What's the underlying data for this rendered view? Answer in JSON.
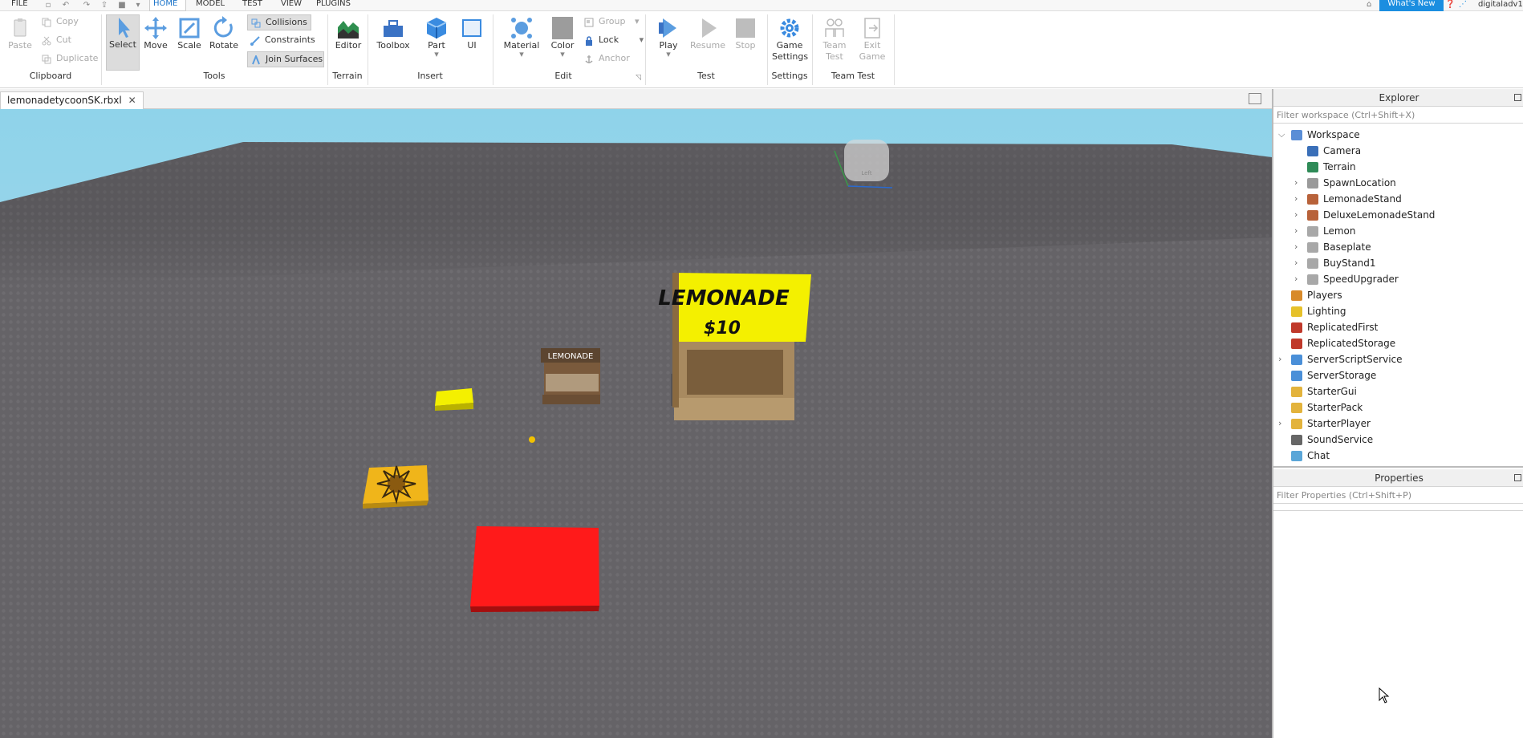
{
  "menubar": {
    "file": "FILE",
    "tabs": [
      "HOME",
      "MODEL",
      "TEST",
      "VIEW",
      "PLUGINS"
    ],
    "whats_new": "What's New",
    "username": "digitaladv1"
  },
  "ribbon": {
    "clipboard": {
      "paste": "Paste",
      "copy": "Copy",
      "cut": "Cut",
      "duplicate": "Duplicate",
      "group_label": "Clipboard"
    },
    "tools": {
      "select": "Select",
      "move": "Move",
      "scale": "Scale",
      "rotate": "Rotate",
      "collisions": "Collisions",
      "constraints": "Constraints",
      "join_surfaces": "Join Surfaces",
      "group_label": "Tools"
    },
    "terrain": {
      "editor": "Editor",
      "group_label": "Terrain"
    },
    "insert": {
      "toolbox": "Toolbox",
      "part": "Part",
      "ui": "UI",
      "group_label": "Insert"
    },
    "edit": {
      "material": "Material",
      "color": "Color",
      "group": "Group",
      "lock": "Lock",
      "anchor": "Anchor",
      "group_label": "Edit"
    },
    "test": {
      "play": "Play",
      "resume": "Resume",
      "stop": "Stop",
      "group_label": "Test"
    },
    "settings": {
      "game_settings_1": "Game",
      "game_settings_2": "Settings",
      "group_label": "Settings"
    },
    "team_test": {
      "team_test_1": "Team",
      "team_test_2": "Test",
      "exit_game_1": "Exit",
      "exit_game_2": "Game",
      "group_label": "Team Test"
    }
  },
  "document_tab": {
    "name": "lemonadetycoonSK.rbxl",
    "close": "✕"
  },
  "viewport": {
    "stand_big_sign_line1": "LEMONADE",
    "stand_big_sign_line2": "$10",
    "stand_small_sign": "LEMONADE",
    "view_cube_label": "Left"
  },
  "explorer": {
    "title": "Explorer",
    "filter_placeholder": "Filter workspace (Ctrl+Shift+X)",
    "items": [
      {
        "label": "Workspace",
        "depth": 0,
        "arrow": "expanded",
        "icon": "globe-icon",
        "color": "#5a8ed6"
      },
      {
        "label": "Camera",
        "depth": 1,
        "arrow": "none",
        "icon": "camera-icon",
        "color": "#3a6fb8"
      },
      {
        "label": "Terrain",
        "depth": 1,
        "arrow": "none",
        "icon": "terrain-icon",
        "color": "#2e8b57"
      },
      {
        "label": "SpawnLocation",
        "depth": 1,
        "arrow": "collapsed",
        "icon": "spawn-icon",
        "color": "#9a9a9a"
      },
      {
        "label": "LemonadeStand",
        "depth": 1,
        "arrow": "collapsed",
        "icon": "model-icon",
        "color": "#b8623a"
      },
      {
        "label": "DeluxeLemonadeStand",
        "depth": 1,
        "arrow": "collapsed",
        "icon": "model-icon",
        "color": "#b8623a"
      },
      {
        "label": "Lemon",
        "depth": 1,
        "arrow": "collapsed",
        "icon": "part-icon",
        "color": "#a8a8a8"
      },
      {
        "label": "Baseplate",
        "depth": 1,
        "arrow": "collapsed",
        "icon": "part-icon",
        "color": "#a8a8a8"
      },
      {
        "label": "BuyStand1",
        "depth": 1,
        "arrow": "collapsed",
        "icon": "part-icon",
        "color": "#a8a8a8"
      },
      {
        "label": "SpeedUpgrader",
        "depth": 1,
        "arrow": "collapsed",
        "icon": "part-icon",
        "color": "#a8a8a8"
      },
      {
        "label": "Players",
        "depth": 0,
        "arrow": "none",
        "icon": "players-icon",
        "color": "#d88a2a"
      },
      {
        "label": "Lighting",
        "depth": 0,
        "arrow": "none",
        "icon": "lightbulb-icon",
        "color": "#e6c12a"
      },
      {
        "label": "ReplicatedFirst",
        "depth": 0,
        "arrow": "none",
        "icon": "replicated-icon",
        "color": "#c0392b"
      },
      {
        "label": "ReplicatedStorage",
        "depth": 0,
        "arrow": "none",
        "icon": "replicated-icon",
        "color": "#c0392b"
      },
      {
        "label": "ServerScriptService",
        "depth": 0,
        "arrow": "collapsed",
        "icon": "script-service-icon",
        "color": "#4a8fd8"
      },
      {
        "label": "ServerStorage",
        "depth": 0,
        "arrow": "none",
        "icon": "storage-icon",
        "color": "#4a8fd8"
      },
      {
        "label": "StarterGui",
        "depth": 0,
        "arrow": "none",
        "icon": "folder-icon",
        "color": "#e3b33c"
      },
      {
        "label": "StarterPack",
        "depth": 0,
        "arrow": "none",
        "icon": "folder-icon",
        "color": "#e3b33c"
      },
      {
        "label": "StarterPlayer",
        "depth": 0,
        "arrow": "collapsed",
        "icon": "folder-icon",
        "color": "#e3b33c"
      },
      {
        "label": "SoundService",
        "depth": 0,
        "arrow": "none",
        "icon": "speaker-icon",
        "color": "#666666"
      },
      {
        "label": "Chat",
        "depth": 0,
        "arrow": "none",
        "icon": "chat-icon",
        "color": "#5aa6d8"
      }
    ]
  },
  "properties": {
    "title": "Properties",
    "filter_placeholder": "Filter Properties (Ctrl+Shift+P)"
  },
  "colors": {
    "accent": "#1b8ee0",
    "ribbon_active": "#1a73c9",
    "sky": "#8fc8e0",
    "baseplate": "#636165",
    "yellow_sign": "#f4f000",
    "red_part": "#ff1a1a"
  }
}
